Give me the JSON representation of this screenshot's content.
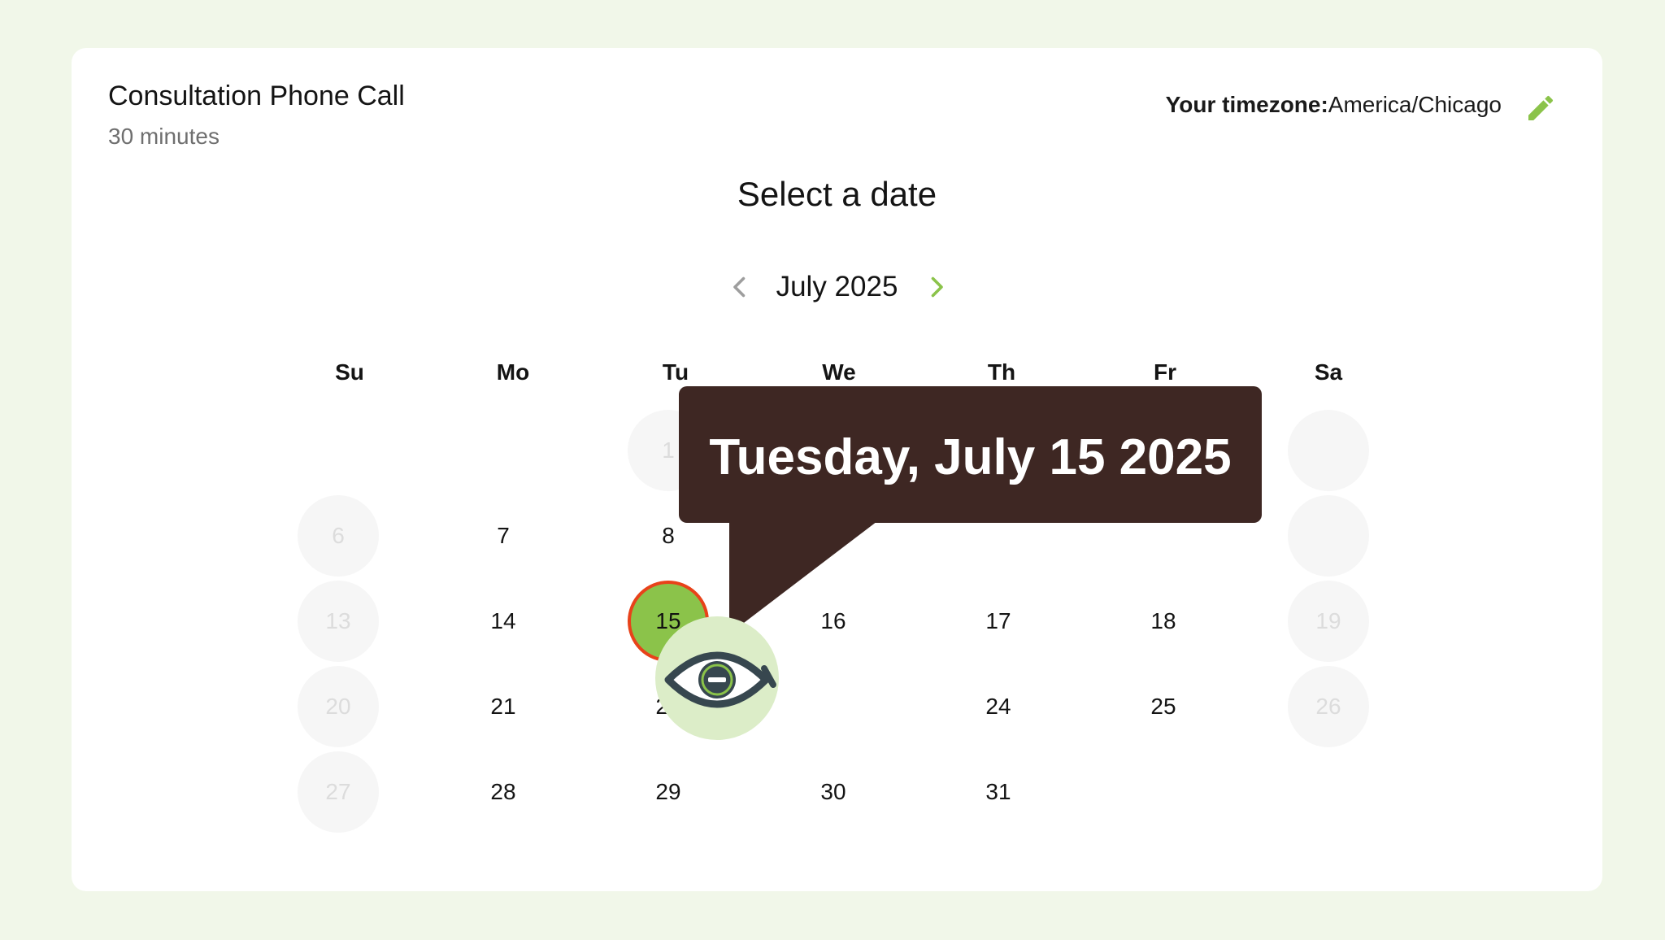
{
  "event": {
    "title": "Consultation Phone Call",
    "duration": "30 minutes"
  },
  "timezone": {
    "label": "Your timezone:",
    "value": "America/Chicago",
    "edit_icon": "pencil-icon",
    "accent": "#8bc34a"
  },
  "heading": "Select a date",
  "calendar": {
    "month_label": "July 2025",
    "prev_icon": "chevron-left-icon",
    "next_icon": "chevron-right-icon",
    "weekdays": [
      "Su",
      "Mo",
      "Tu",
      "We",
      "Th",
      "Fr",
      "Sa"
    ],
    "days": {
      "d1": "1",
      "d6": "6",
      "d7": "7",
      "d8": "8",
      "d13": "13",
      "d14": "14",
      "d15": "15",
      "d16": "16",
      "d17": "17",
      "d18": "18",
      "d19": "19",
      "d20": "20",
      "d21": "21",
      "d22": "22",
      "d24": "24",
      "d25": "25",
      "d26": "26",
      "d27": "27",
      "d28": "28",
      "d29": "29",
      "d30": "30",
      "d31": "31"
    },
    "selected_day": "15",
    "colors": {
      "selected_fill": "#8bc34a",
      "selected_ring": "#e8421a",
      "disabled_bg": "#f6f6f6",
      "disabled_text": "#dcdcdc"
    }
  },
  "tooltip": {
    "text": "Tuesday, July 15 2025",
    "background": "#3e2723"
  },
  "overlay": {
    "icon": "eye-minus-icon",
    "background": "#dcedc8"
  },
  "page": {
    "background": "#f1f7e9"
  }
}
